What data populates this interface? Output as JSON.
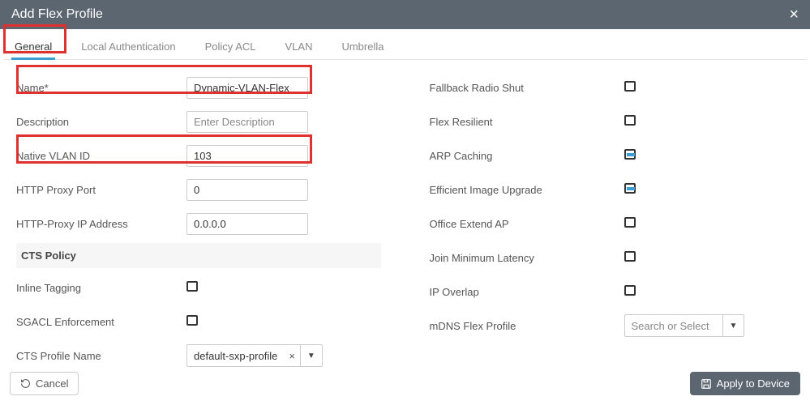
{
  "header": {
    "title": "Add Flex Profile"
  },
  "tabs": {
    "general": "General",
    "local_auth": "Local Authentication",
    "policy_acl": "Policy ACL",
    "vlan": "VLAN",
    "umbrella": "Umbrella"
  },
  "left": {
    "name_label": "Name*",
    "name_value": "Dynamic-VLAN-Flex",
    "desc_label": "Description",
    "desc_placeholder": "Enter Description",
    "native_vlan_label": "Native VLAN ID",
    "native_vlan_value": "103",
    "http_proxy_port_label": "HTTP Proxy Port",
    "http_proxy_port_value": "0",
    "http_proxy_ip_label": "HTTP-Proxy IP Address",
    "http_proxy_ip_value": "0.0.0.0",
    "cts_policy_header": "CTS Policy",
    "inline_tagging_label": "Inline Tagging",
    "sgacl_label": "SGACL Enforcement",
    "cts_profile_label": "CTS Profile Name",
    "cts_profile_value": "default-sxp-profile"
  },
  "right": {
    "fallback_label": "Fallback Radio Shut",
    "flex_resilient_label": "Flex Resilient",
    "arp_caching_label": "ARP Caching",
    "efficient_upgrade_label": "Efficient Image Upgrade",
    "office_extend_label": "Office Extend AP",
    "join_latency_label": "Join Minimum Latency",
    "ip_overlap_label": "IP Overlap",
    "mdns_label": "mDNS Flex Profile",
    "mdns_placeholder": "Search or Select"
  },
  "footer": {
    "cancel": "Cancel",
    "apply": "Apply to Device"
  }
}
